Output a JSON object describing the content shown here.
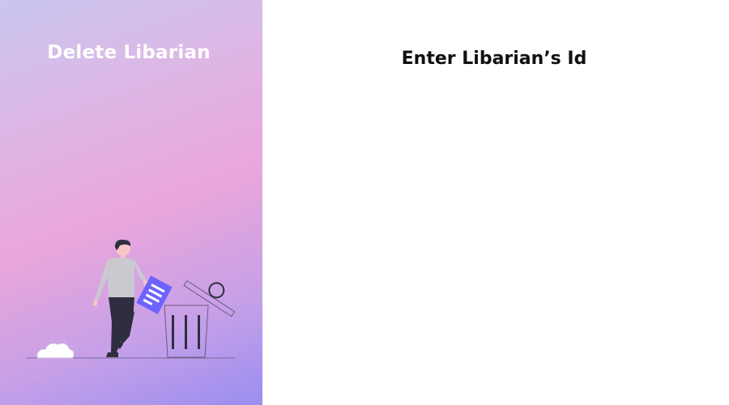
{
  "sidebar": {
    "title": "Delete Libarian",
    "illustration_icon": "person-discarding-document-illustration"
  },
  "main": {
    "heading": "Enter Libarian’s Id"
  },
  "colors": {
    "gradient_start": "#c9c6f0",
    "gradient_mid": "#eaa6da",
    "gradient_end": "#9a8ef0",
    "document_accent": "#6c63ff"
  }
}
